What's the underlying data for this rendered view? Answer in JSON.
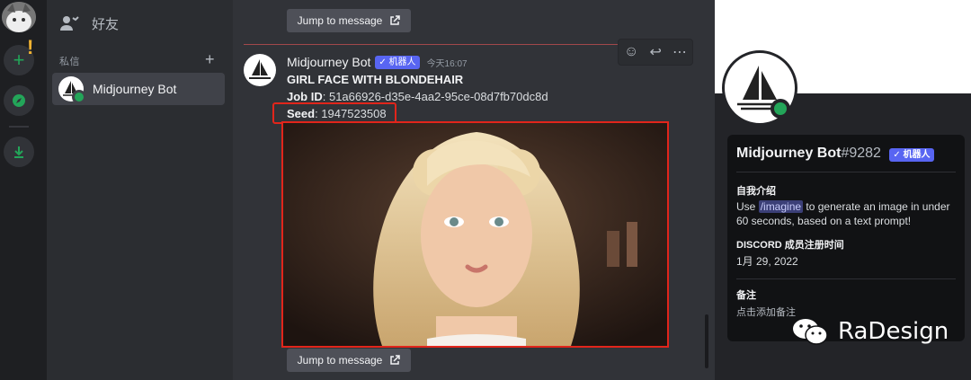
{
  "rail": {
    "avatar_desc": "cat",
    "add_server_icon": "plus-icon",
    "explore_icon": "compass-icon",
    "download_icon": "download-icon",
    "alert": "!"
  },
  "dm_sidebar": {
    "friends_label": "好友",
    "section_label": "私信",
    "add_label": "+",
    "items": [
      {
        "label": "Midjourney Bot"
      }
    ]
  },
  "chat": {
    "jump_label": "Jump to message",
    "message": {
      "author": "Midjourney Bot",
      "bot_tag": "✓ 机器人",
      "timestamp": "今天16:07",
      "title": "GIRL FACE WITH BLONDEHAIR",
      "job_label": "Job ID",
      "job_value": ": 51a66926-d35e-4aa2-95ce-08d7fb70dc8d",
      "seed_label": "Seed",
      "seed_value": ": 1947523508"
    }
  },
  "profile": {
    "name": "Midjourney Bot",
    "discriminator": "#9282",
    "bot_tag": "✓ 机器人",
    "about_title": "自我介绍",
    "about_pre": "Use ",
    "about_cmd": "/imagine",
    "about_post": " to generate an image in under 60 seconds, based on a text prompt!",
    "member_since_title": "DISCORD 成员注册时间",
    "member_since": "1月 29, 2022",
    "note_title": "备注",
    "note_placeholder": "点击添加备注"
  },
  "watermark": {
    "text": "RaDesign"
  },
  "colors": {
    "accent": "#5865f2",
    "online": "#23a559",
    "highlight": "#e1251b"
  }
}
